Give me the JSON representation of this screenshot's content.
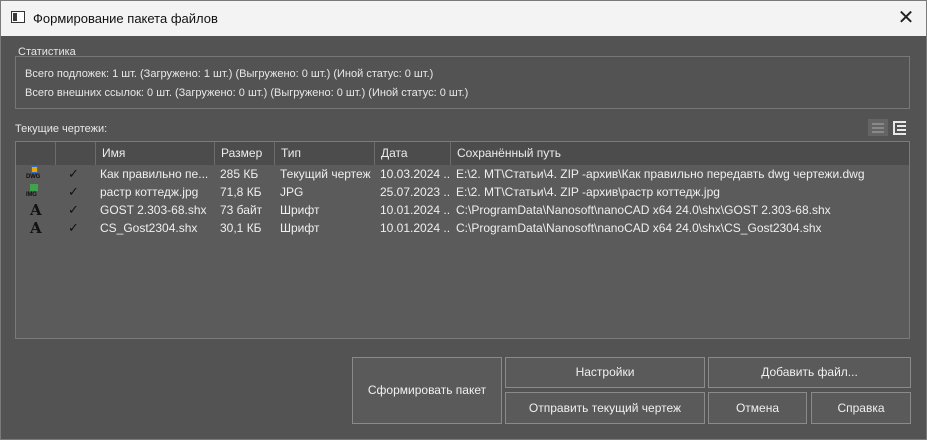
{
  "window": {
    "title": "Формирование пакета файлов",
    "close_glyph": "✕"
  },
  "stats": {
    "legend": "Статистика",
    "line1": "Всего подложек: 1 шт. (Загружено: 1 шт.) (Выгружено: 0 шт.) (Иной статус: 0 шт.)",
    "line2": "Всего внешних ссылок: 0 шт. (Загружено: 0 шт.) (Выгружено: 0 шт.) (Иной статус: 0 шт.)"
  },
  "current_drawings": {
    "label": "Текущие чертежи:",
    "columns": [
      "",
      "",
      "Имя",
      "Размер",
      "Тип",
      "Дата",
      "Сохранённый путь"
    ],
    "rows": [
      {
        "icon": "dwg-file-icon",
        "icon_label": "DWG",
        "checked": "✓",
        "name": "Как правильно пе...",
        "size": "285 КБ",
        "type": "Текущий чертеж",
        "date": "10.03.2024 ...",
        "path": "E:\\2. MT\\Статьи\\4. ZIP -архив\\Как правильно передавть dwg чертежи.dwg"
      },
      {
        "icon": "image-file-icon",
        "icon_label": "IMG",
        "checked": "✓",
        "name": "растр коттедж.jpg",
        "size": "71,8 КБ",
        "type": "JPG",
        "date": "25.07.2023 ...",
        "path": "E:\\2. MT\\Статьи\\4. ZIP -архив\\растр коттедж.jpg"
      },
      {
        "icon": "font-file-icon",
        "icon_label": "A",
        "checked": "✓",
        "name": "GOST 2.303-68.shx",
        "size": "73 байт",
        "type": "Шрифт",
        "date": "10.01.2024 ...",
        "path": "C:\\ProgramData\\Nanosoft\\nanoCAD x64 24.0\\shx\\GOST 2.303-68.shx"
      },
      {
        "icon": "font-file-icon",
        "icon_label": "A",
        "checked": "✓",
        "name": "CS_Gost2304.shx",
        "size": "30,1 КБ",
        "type": "Шрифт",
        "date": "10.01.2024 ...",
        "path": "C:\\ProgramData\\Nanosoft\\nanoCAD x64 24.0\\shx\\CS_Gost2304.shx"
      }
    ]
  },
  "buttons": {
    "form_package": "Сформировать пакет",
    "settings": "Настройки",
    "add_file": "Добавить файл...",
    "send_current": "Отправить текущий чертеж",
    "cancel": "Отмена",
    "help": "Справка"
  }
}
